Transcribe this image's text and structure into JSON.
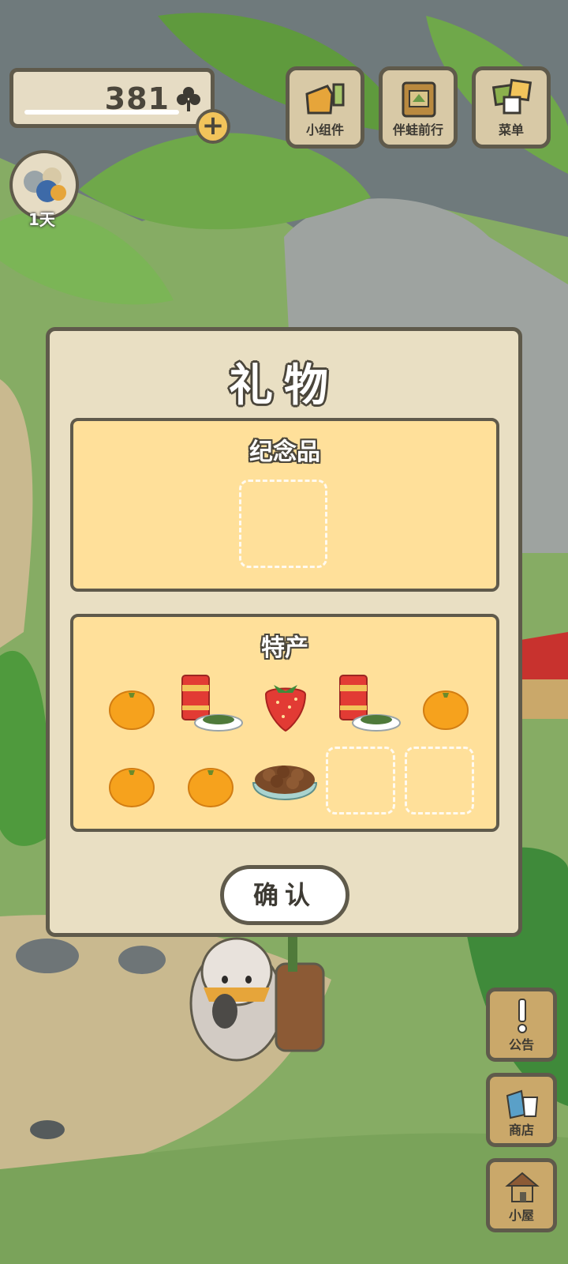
{
  "hud": {
    "clover_count": "381",
    "plus_label": "+",
    "buttons": [
      {
        "label": "小组件",
        "icon": "widget-icon"
      },
      {
        "label": "伴蛙前行",
        "icon": "travel-book-icon"
      },
      {
        "label": "菜单",
        "icon": "menu-icon"
      }
    ],
    "visitor_days": "1天"
  },
  "dialog": {
    "title": "礼物",
    "souvenir": {
      "title": "纪念品",
      "items": []
    },
    "specialty": {
      "title": "特产",
      "items": [
        {
          "name": "orange",
          "icon": "orange-icon"
        },
        {
          "name": "tea-can-with-leaves",
          "icon": "tea-can-icon"
        },
        {
          "name": "strawberry",
          "icon": "strawberry-icon"
        },
        {
          "name": "tea-can-with-leaves",
          "icon": "tea-can-icon"
        },
        {
          "name": "orange",
          "icon": "orange-icon"
        },
        {
          "name": "orange",
          "icon": "orange-icon"
        },
        {
          "name": "orange",
          "icon": "orange-icon"
        },
        {
          "name": "chestnut-bowl",
          "icon": "chestnut-bowl-icon"
        }
      ],
      "empty_slots": 2
    },
    "confirm_label": "确认"
  },
  "side_buttons": [
    {
      "label": "公告",
      "icon": "exclamation-icon"
    },
    {
      "label": "商店",
      "icon": "shop-bag-icon"
    },
    {
      "label": "小屋",
      "icon": "house-icon"
    }
  ],
  "colors": {
    "outline": "#5f5a4b",
    "panel_fill": "#ffe09a",
    "dialog_fill": "#e9dfc3",
    "orange": "#f6a21d",
    "strawberry": "#e23b34"
  }
}
